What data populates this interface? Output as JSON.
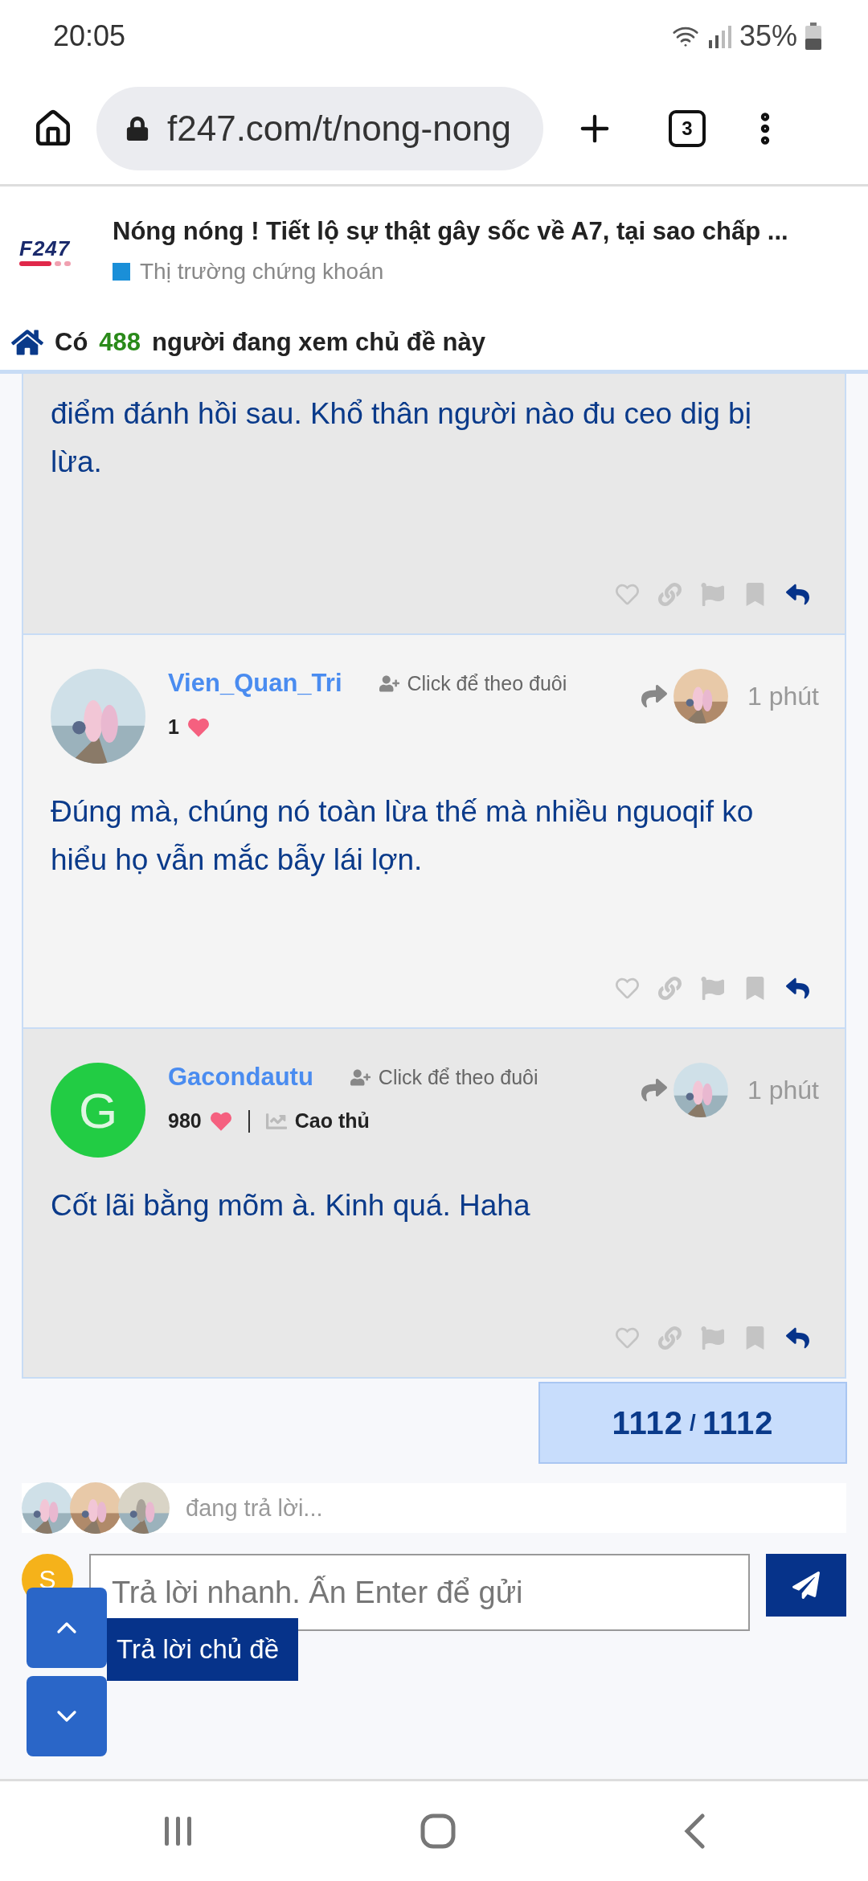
{
  "status_bar": {
    "time": "20:05",
    "battery": "35%"
  },
  "browser": {
    "url": "f247.com/t/nong-nong",
    "tab_count": "3"
  },
  "topic": {
    "logo": "F247",
    "title": "Nóng nóng ! Tiết lộ sự thật gây sốc về A7, tại sao chấp ...",
    "category": "Thị trường chứng khoán"
  },
  "viewers": {
    "prefix": "Có",
    "count": "488",
    "suffix": "người đang xem chủ đề này"
  },
  "posts": [
    {
      "body": "điểm đánh hồi sau. Khổ thân người nào đu ceo dig bị lừa."
    },
    {
      "author": "Vien_Quan_Tri",
      "follow": "Click để theo đuôi",
      "likes": "1",
      "time": "1 phút",
      "body": "Đúng mà, chúng nó toàn lừa thế mà nhiều nguoqif ko hiểu họ vẫn mắc bẫy lái lợn."
    },
    {
      "author": "Gacondautu",
      "avatar": {
        "kind": "letter",
        "letter": "G"
      },
      "follow": "Click để theo đuôi",
      "likes": "980",
      "rank": "Cao thủ",
      "time": "1 phút",
      "body": "Cốt lãi bằng mõm à. Kinh quá. Haha"
    }
  ],
  "counter": {
    "current": "1112",
    "separator": "/",
    "total": "1112"
  },
  "typing": {
    "text": "đang trả lời..."
  },
  "reply": {
    "avatar_letter": "S",
    "placeholder": "Trả lời nhanh. Ấn Enter để gửi",
    "topic_button": "Trả lời chủ đề"
  }
}
